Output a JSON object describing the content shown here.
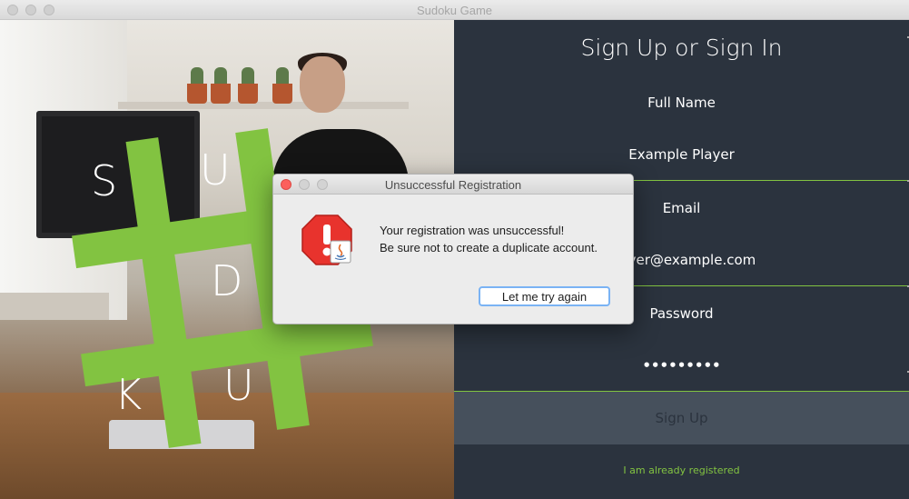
{
  "window": {
    "title": "Sudoku Game"
  },
  "logo": {
    "letters": [
      "S",
      "U",
      "D",
      "K",
      "U"
    ]
  },
  "form": {
    "heading": "Sign Up or Sign In",
    "full_name_label": "Full Name",
    "full_name_value": "Example Player",
    "email_label": "Email",
    "email_value": "player@example.com",
    "password_label": "Password",
    "password_value": "•••••••••",
    "signup_label": "Sign Up",
    "registered_link": "I am already registered"
  },
  "dialog": {
    "title": "Unsuccessful Registration",
    "line1": "Your registration was unsuccessful!",
    "line2": "Be sure not to create a duplicate account.",
    "button_label": "Let me try again",
    "icon": "warning-stop-icon"
  },
  "colors": {
    "accent": "#82c341",
    "panel_bg": "#2b333e",
    "button_bg": "#46505c"
  }
}
